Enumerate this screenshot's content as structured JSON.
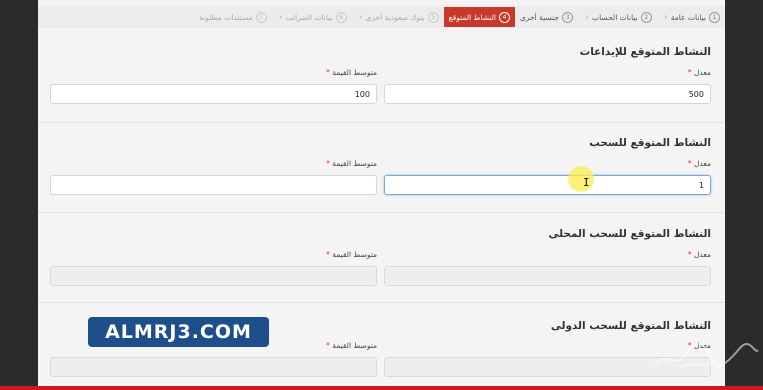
{
  "stepper": {
    "steps": [
      {
        "label": "بيانات عامة",
        "num": "1"
      },
      {
        "label": "بيانات الحساب",
        "num": "2"
      },
      {
        "label": "جنسية أخرى",
        "num": "3"
      },
      {
        "label": "النشاط المتوقع",
        "num": "4"
      },
      {
        "label": "بنوك سعودية أخرى",
        "num": "5"
      },
      {
        "label": "بيانات الضرائب",
        "num": "6"
      },
      {
        "label": "مستندات مطلوبة",
        "num": "7"
      }
    ],
    "active_index": 3
  },
  "sections": {
    "deposits": {
      "title": "النشاط المتوقع للإيداعات",
      "rate_label": "معدل",
      "rate_value": "500",
      "avg_label": "متوسط القيمة",
      "avg_value": "100"
    },
    "withdrawals": {
      "title": "النشاط المتوقع للسحب",
      "rate_label": "معدل",
      "rate_value": "1",
      "avg_label": "متوسط القيمة",
      "avg_value": ""
    },
    "local_withdrawals": {
      "title": "النشاط المتوقع للسحب المحلى",
      "rate_label": "معدل",
      "rate_value": "",
      "avg_label": "متوسط القيمة",
      "avg_value": ""
    },
    "intl_withdrawals": {
      "title": "النشاط المتوقع للسحب الدولى",
      "rate_label": "معدل",
      "rate_value": "",
      "avg_label": "متوسط القيمة",
      "avg_value": ""
    }
  },
  "required_marker": "*",
  "watermark": {
    "text": "ALMRJ3.COM"
  },
  "colors": {
    "active_step": "#c8382b",
    "watermark_bg": "#1e4f8b",
    "required": "#dd3333"
  }
}
